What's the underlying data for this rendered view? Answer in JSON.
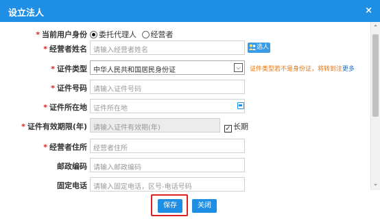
{
  "dialog": {
    "title": "设立法人",
    "close_label": "×"
  },
  "user_identity": {
    "label": "当前用户身份",
    "options": [
      "委托代理人",
      "经营者"
    ],
    "selected": "委托代理人"
  },
  "operator_name": {
    "label": "经营者姓名",
    "placeholder": "请输入经营者姓名",
    "select_button": "选人"
  },
  "id_type": {
    "label": "证件类型",
    "value": "中华人民共和国居民身份证",
    "hint": "证件类型若不是身份证，将转到注",
    "hint_link": "更多"
  },
  "id_number": {
    "label": "证件号码",
    "placeholder": "请输入证件号码"
  },
  "id_location": {
    "label": "证件所在地",
    "placeholder": "证件所在地"
  },
  "id_validity": {
    "label": "证件有效期限(年)",
    "placeholder": "请输入证件有效期(年)",
    "long_term_label": "长期",
    "long_term_checked": true
  },
  "operator_address": {
    "label": "经营者住所",
    "placeholder": "经营者住所"
  },
  "postal_code": {
    "label": "邮政编码",
    "placeholder": "请输入邮政编码"
  },
  "landline": {
    "label": "固定电话",
    "placeholder": "请输入固定电话，区号-电话号码"
  },
  "footer": {
    "save_label": "保存",
    "close_label": "关闭"
  },
  "colors": {
    "header": "#1e8fe5",
    "required": "#e02020",
    "hint": "#e8730c"
  }
}
